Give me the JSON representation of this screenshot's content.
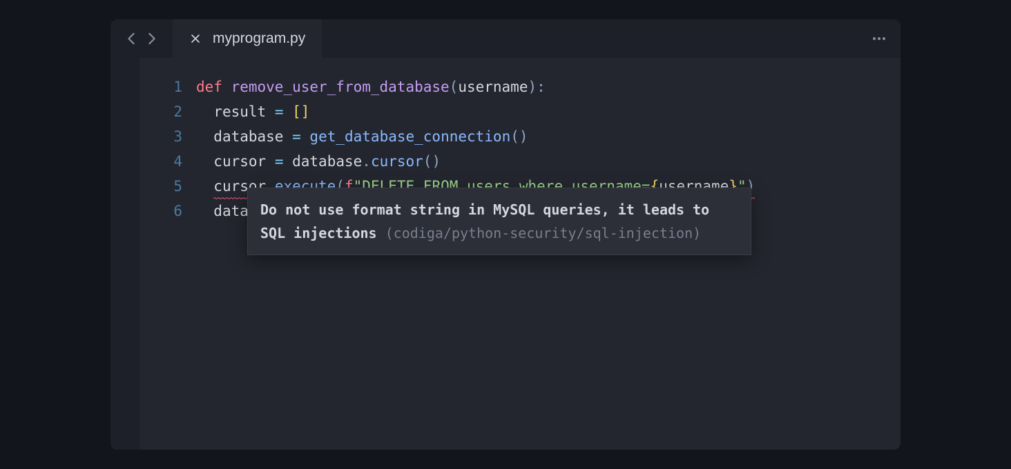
{
  "tab": {
    "title": "myprogram.py"
  },
  "gutter": [
    "1",
    "2",
    "3",
    "4",
    "5",
    "6"
  ],
  "code": {
    "line1": {
      "def": "def",
      "space1": " ",
      "func": "remove_user_from_database",
      "p_open": "(",
      "param": "username",
      "p_close": ")",
      "colon": ":"
    },
    "line2": {
      "indent": "  ",
      "var": "result",
      "space1": " ",
      "eq": "=",
      "space2": " ",
      "bopen": "[",
      "bclose": "]"
    },
    "line3": {
      "indent": "  ",
      "var": "database",
      "space1": " ",
      "eq": "=",
      "space2": " ",
      "call": "get_database_connection",
      "popen": "(",
      "pclose": ")"
    },
    "line4": {
      "indent": "  ",
      "var": "cursor",
      "space1": " ",
      "eq": "=",
      "space2": " ",
      "obj": "database",
      "dot": ".",
      "method": "cursor",
      "popen": "(",
      "pclose": ")"
    },
    "line5": {
      "indent": "  ",
      "obj": "cursor",
      "dot": ".",
      "method": "execute",
      "popen": "(",
      "fprefix": "f",
      "q1": "\"",
      "sql": "DELETE FROM users where username=",
      "fbopen": "{",
      "fvar": "username",
      "fbclose": "}",
      "q2": "\"",
      "pclose": ")"
    },
    "line6": {
      "indent": "  ",
      "partial": "datab"
    }
  },
  "tooltip": {
    "message": "Do not use format string in MySQL queries, it leads to SQL injections",
    "rule": " (codiga/python-security/sql-injection)"
  }
}
